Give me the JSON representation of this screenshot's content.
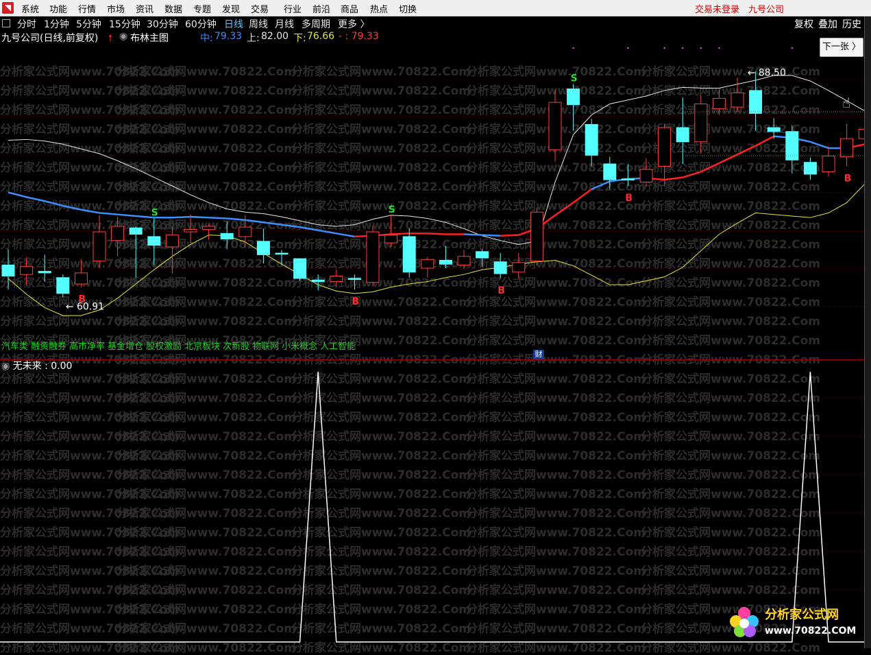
{
  "menubar": {
    "items": [
      "系统",
      "功能",
      "行情",
      "市场",
      "资讯",
      "数据",
      "专题",
      "发现",
      "交易",
      "行业",
      "前沿",
      "商品",
      "热点",
      "切换"
    ],
    "login_status": "交易未登录",
    "stock_name": "九号公司"
  },
  "periods": {
    "items": [
      "分时",
      "1分钟",
      "5分钟",
      "15分钟",
      "30分钟",
      "60分钟",
      "日线",
      "周线",
      "月线",
      "多周期",
      "更多 〉"
    ],
    "active": "日线"
  },
  "toolbar_right": [
    "复权",
    "叠加",
    "历史"
  ],
  "info": {
    "stock_title": "九号公司(日线,前复权)",
    "indicator": "布林主图",
    "mid_label": "中:",
    "mid_value": "79.33",
    "up_label": "上:",
    "up_value": "82.00",
    "low_label": "下:",
    "low_value": "76.66",
    "last_value": "- : 79.33"
  },
  "next_button": "下一张 〉",
  "concepts": [
    "汽车类",
    "融资融券",
    "高市净率",
    "基金增仓",
    "股权激励",
    "北京板块",
    "次新股",
    "物联网",
    "小米概念",
    "人工智能"
  ],
  "cai_badge": "财",
  "sub_indicator": {
    "name": "无未来",
    "value": "0.00"
  },
  "watermark": {
    "text": "分析家公式网www.70822.Com"
  },
  "logo": {
    "title": "分析家公式网",
    "url": "www.70822.COM"
  },
  "colors": {
    "up_candle": "#ff3b3b",
    "down_candle": "#54ffff",
    "mid_line_early": "#3c8fff",
    "mid_line_late": "#ff2020",
    "upper_band": "#e8e8e8",
    "lower_band": "#e6e628",
    "buy_mark": "#ff2a2a",
    "sell_mark": "#28e028",
    "concept_text": "#1ed41e"
  },
  "chart_data": {
    "type": "candlestick",
    "price_annotations": {
      "high": "88.50",
      "low": "60.91"
    },
    "signal_labels": {
      "buy": "B",
      "sell": "S"
    },
    "candles": [
      {
        "o": 64.0,
        "c": 62.6,
        "h": 66.0,
        "l": 60.9
      },
      {
        "o": 62.8,
        "c": 63.8,
        "h": 65.0,
        "l": 61.5
      },
      {
        "o": 63.2,
        "c": 63.0,
        "h": 65.3,
        "l": 61.9
      },
      {
        "o": 62.4,
        "c": 60.4,
        "h": 62.8,
        "l": 59.9
      },
      {
        "o": 61.6,
        "c": 63.0,
        "h": 64.7,
        "l": 61.2
      },
      {
        "o": 64.5,
        "c": 68.2,
        "h": 70.3,
        "l": 63.6
      },
      {
        "o": 67.1,
        "c": 68.9,
        "h": 70.1,
        "l": 65.1
      },
      {
        "o": 68.7,
        "c": 67.9,
        "h": 68.9,
        "l": 62.4
      },
      {
        "o": 67.6,
        "c": 66.5,
        "h": 69.9,
        "l": 64.0
      },
      {
        "o": 66.3,
        "c": 67.8,
        "h": 68.9,
        "l": 62.9
      },
      {
        "o": 68.2,
        "c": 68.5,
        "h": 70.4,
        "l": 66.8
      },
      {
        "o": 68.5,
        "c": 68.9,
        "h": 69.2,
        "l": 67.2
      },
      {
        "o": 68.0,
        "c": 67.3,
        "h": 69.5,
        "l": 66.0
      },
      {
        "o": 67.6,
        "c": 68.8,
        "h": 70.3,
        "l": 66.2
      },
      {
        "o": 67.0,
        "c": 65.3,
        "h": 68.6,
        "l": 64.2
      },
      {
        "o": 65.5,
        "c": 65.4,
        "h": 65.9,
        "l": 64.0
      },
      {
        "o": 64.8,
        "c": 62.3,
        "h": 64.8,
        "l": 62.0
      },
      {
        "o": 62.1,
        "c": 61.9,
        "h": 62.8,
        "l": 60.8
      },
      {
        "o": 61.9,
        "c": 62.6,
        "h": 63.4,
        "l": 61.3
      },
      {
        "o": 62.3,
        "c": 62.2,
        "h": 62.8,
        "l": 60.9
      },
      {
        "o": 61.8,
        "c": 68.2,
        "h": 69.0,
        "l": 61.3
      },
      {
        "o": 66.8,
        "c": 67.8,
        "h": 70.3,
        "l": 66.3
      },
      {
        "o": 67.6,
        "c": 63.1,
        "h": 68.6,
        "l": 62.4
      },
      {
        "o": 63.6,
        "c": 64.7,
        "h": 65.0,
        "l": 62.4
      },
      {
        "o": 64.6,
        "c": 64.1,
        "h": 66.4,
        "l": 63.6
      },
      {
        "o": 64.0,
        "c": 65.1,
        "h": 65.9,
        "l": 63.5
      },
      {
        "o": 65.7,
        "c": 64.9,
        "h": 66.0,
        "l": 63.8
      },
      {
        "o": 64.4,
        "c": 62.9,
        "h": 65.5,
        "l": 62.3
      },
      {
        "o": 63.1,
        "c": 64.3,
        "h": 65.5,
        "l": 62.3
      },
      {
        "o": 64.5,
        "c": 70.7,
        "h": 71.3,
        "l": 63.9
      },
      {
        "o": 78.6,
        "c": 84.6,
        "h": 86.2,
        "l": 77.1
      },
      {
        "o": 86.3,
        "c": 84.3,
        "h": 86.9,
        "l": 81.0
      },
      {
        "o": 81.8,
        "c": 77.9,
        "h": 82.5,
        "l": 76.5
      },
      {
        "o": 76.8,
        "c": 74.8,
        "h": 77.7,
        "l": 73.6
      },
      {
        "o": 74.9,
        "c": 74.8,
        "h": 76.8,
        "l": 74.0
      },
      {
        "o": 74.5,
        "c": 76.1,
        "h": 77.5,
        "l": 74.0
      },
      {
        "o": 76.5,
        "c": 81.4,
        "h": 81.9,
        "l": 74.0
      },
      {
        "o": 81.4,
        "c": 79.6,
        "h": 85.2,
        "l": 76.8
      },
      {
        "o": 79.6,
        "c": 84.4,
        "h": 85.5,
        "l": 78.2
      },
      {
        "o": 83.8,
        "c": 85.1,
        "h": 86.2,
        "l": 83.0
      },
      {
        "o": 84.0,
        "c": 85.8,
        "h": 87.7,
        "l": 83.4
      },
      {
        "o": 86.1,
        "c": 83.2,
        "h": 88.5,
        "l": 81.0
      },
      {
        "o": 81.4,
        "c": 80.9,
        "h": 82.6,
        "l": 80.0
      },
      {
        "o": 80.9,
        "c": 77.3,
        "h": 81.7,
        "l": 75.6
      },
      {
        "o": 77.0,
        "c": 75.5,
        "h": 77.6,
        "l": 74.8
      },
      {
        "o": 75.8,
        "c": 77.8,
        "h": 79.0,
        "l": 75.2
      },
      {
        "o": 77.7,
        "c": 80.0,
        "h": 81.9,
        "l": 76.5
      },
      {
        "o": 80.0,
        "c": 81.2,
        "h": 83.6,
        "l": 80.0
      }
    ],
    "mid_band": [
      73.2,
      72.6,
      72.1,
      71.5,
      71.0,
      70.6,
      70.4,
      70.2,
      70.0,
      70.0,
      70.1,
      70.0,
      69.9,
      69.7,
      69.4,
      69.1,
      68.8,
      68.4,
      68.0,
      67.6,
      67.7,
      67.9,
      68.0,
      68.0,
      67.9,
      67.9,
      67.8,
      67.7,
      67.8,
      68.6,
      70.3,
      71.9,
      73.6,
      74.6,
      74.9,
      75.0,
      74.8,
      75.1,
      75.8,
      76.9,
      78.0,
      79.1,
      80.3,
      80.1,
      79.6,
      78.8,
      78.8,
      79.3
    ],
    "upper_band": [
      79.8,
      79.9,
      79.7,
      79.3,
      78.7,
      78.1,
      77.2,
      76.2,
      75.1,
      74.0,
      72.9,
      71.9,
      71.1,
      70.7,
      70.5,
      70.1,
      69.6,
      69.1,
      68.9,
      69.1,
      69.8,
      70.3,
      70.2,
      69.9,
      69.4,
      68.6,
      67.7,
      67.1,
      66.6,
      67.0,
      74.5,
      80.5,
      83.0,
      84.4,
      84.9,
      85.4,
      86.1,
      86.5,
      86.4,
      86.4,
      86.9,
      87.4,
      88.0,
      88.0,
      87.3,
      86.1,
      84.8,
      83.5
    ],
    "lower_band": [
      62.3,
      60.3,
      58.6,
      57.6,
      57.6,
      58.3,
      59.8,
      61.6,
      63.4,
      65.1,
      66.6,
      67.8,
      67.7,
      66.9,
      65.5,
      64.1,
      62.8,
      61.5,
      60.7,
      60.4,
      60.6,
      61.2,
      61.6,
      61.9,
      62.4,
      62.8,
      63.4,
      63.7,
      64.1,
      64.4,
      64.6,
      63.9,
      62.7,
      61.5,
      61.5,
      62.0,
      62.5,
      63.7,
      65.8,
      67.9,
      69.3,
      70.6,
      70.4,
      70.2,
      70.0,
      70.6,
      71.9,
      74.3
    ],
    "sub_series": [
      0,
      0,
      0,
      0,
      0,
      0,
      0,
      0,
      0,
      0,
      0,
      0,
      0,
      0,
      0,
      0,
      0,
      1,
      0,
      0,
      0,
      0,
      0,
      0,
      0,
      0,
      0,
      0,
      0,
      0,
      0,
      0,
      0,
      0,
      0,
      0,
      0,
      0,
      0,
      0,
      0,
      0,
      0,
      0,
      1,
      0,
      0,
      0
    ],
    "buy_signals": [
      4,
      19,
      27,
      34,
      46
    ],
    "sell_signals": [
      8,
      21,
      31
    ],
    "ylim": [
      55,
      92
    ]
  }
}
